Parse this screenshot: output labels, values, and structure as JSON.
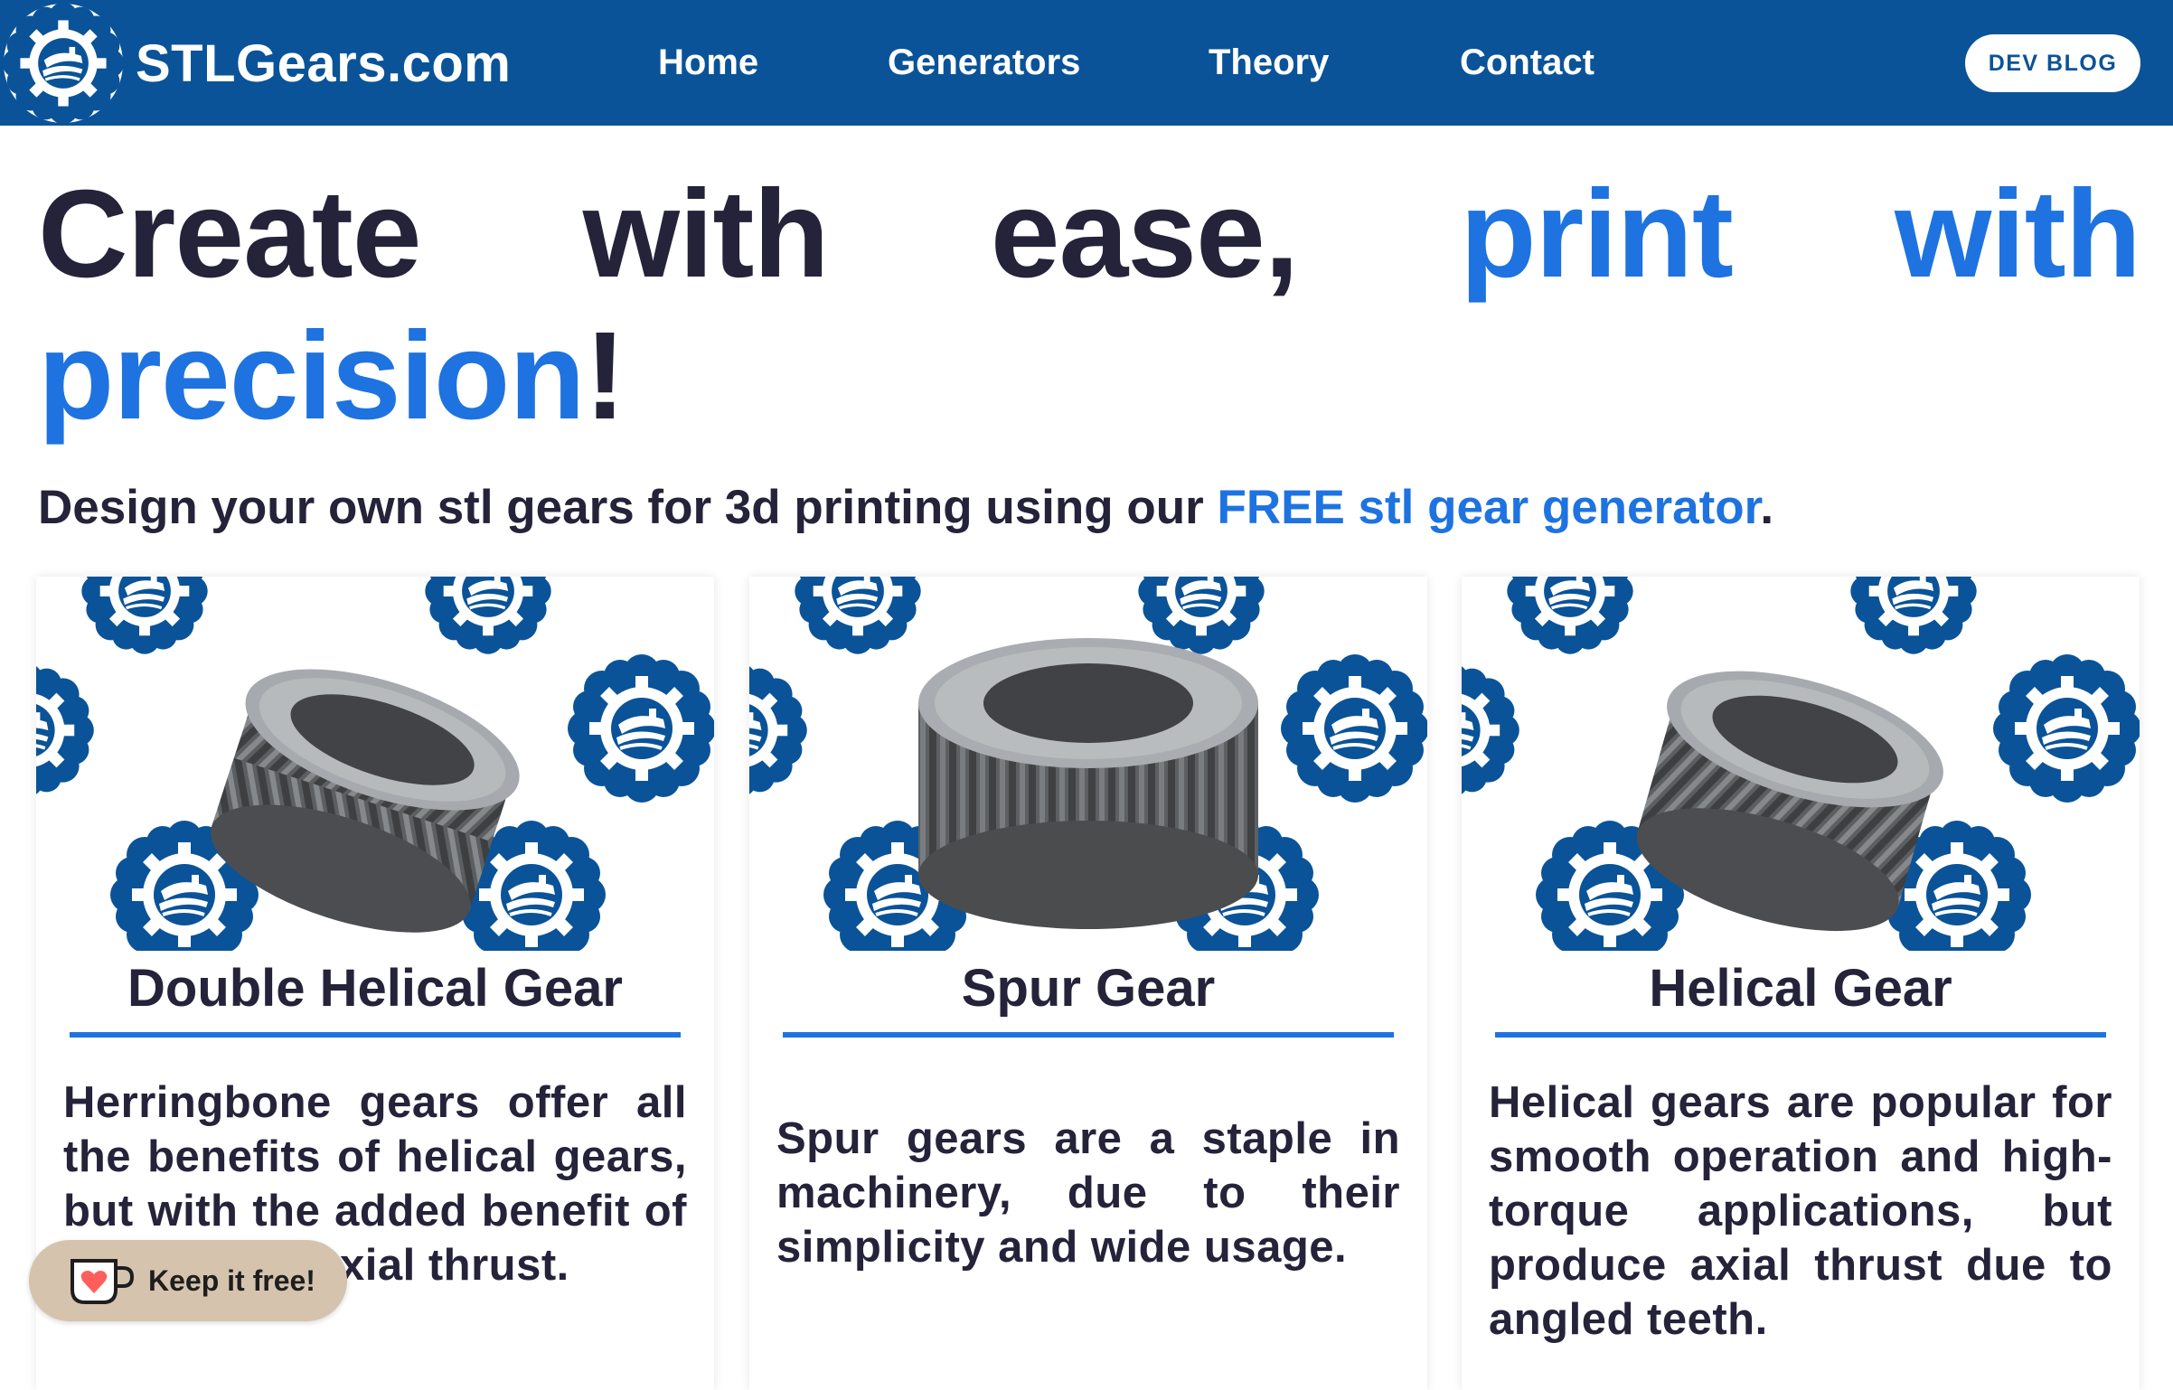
{
  "nav": {
    "brand": "STLGears.com",
    "links": [
      {
        "label": "Home"
      },
      {
        "label": "Generators"
      },
      {
        "label": "Theory"
      },
      {
        "label": "Contact"
      }
    ],
    "dev_blog_label": "DEV BLOG",
    "background_color": "#0a5398"
  },
  "hero": {
    "words_line1": [
      "Create",
      "with",
      "ease,",
      "print",
      "with"
    ],
    "word_precision": "precision",
    "exclaim": "!",
    "subtitle_prefix": "Design your own stl gears for 3d printing using our ",
    "subtitle_link": "FREE stl gear generator",
    "subtitle_suffix": ".",
    "accent_color": "#1e73e0",
    "text_color": "#25233a"
  },
  "cards": [
    {
      "title": "Double Helical Gear",
      "description": "Herringbone gears offer all the benefits of helical gears, but with the added benefit of eliminating axial thrust.",
      "gear_icon": "double-helical-gear-image"
    },
    {
      "title": "Spur Gear",
      "description": "Spur gears are a staple in machinery, due to their simplicity and wide usage.",
      "gear_icon": "spur-gear-image"
    },
    {
      "title": "Helical Gear",
      "description": "Helical gears are popular for smooth operation and high-torque applications, but produce axial thrust due to angled teeth.",
      "gear_icon": "helical-gear-image"
    }
  ],
  "kofi": {
    "label": "Keep it free!",
    "icon": "coffee-cup-heart-icon"
  }
}
